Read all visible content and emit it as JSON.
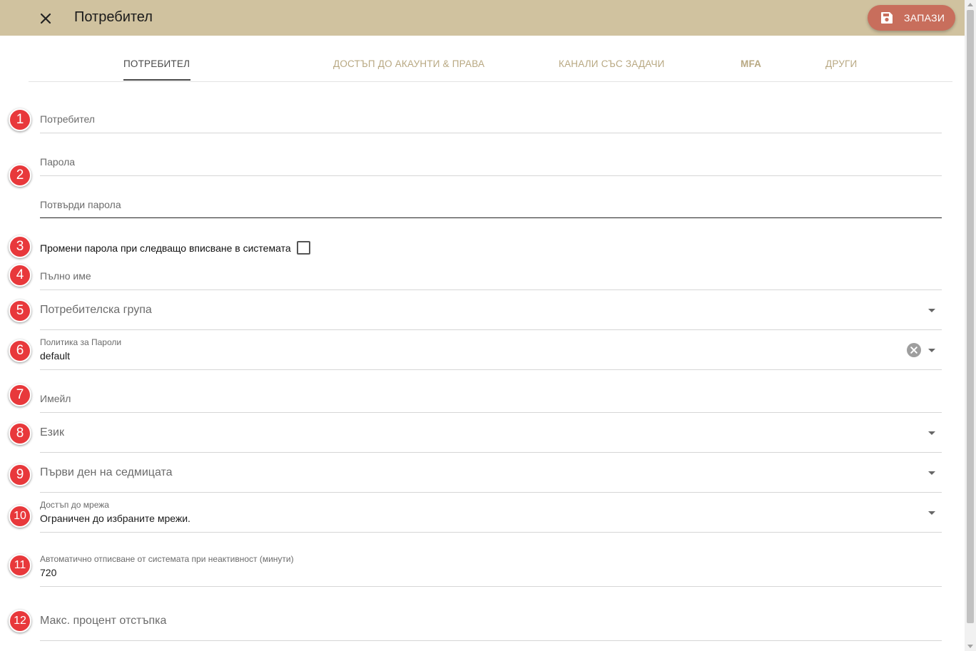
{
  "header": {
    "title": "Потребител",
    "save_label": "ЗАПАЗИ"
  },
  "tabs": [
    {
      "label": "Потребител",
      "active": true
    },
    {
      "label": "Достъп до акаунти & права",
      "active": false
    },
    {
      "label": "Канали със задачи",
      "active": false
    },
    {
      "label": "MFA",
      "active": false
    },
    {
      "label": "Други",
      "active": false
    }
  ],
  "form": {
    "username": {
      "placeholder": "Потребител"
    },
    "password": {
      "placeholder": "Парола"
    },
    "confirm_password": {
      "placeholder": "Потвърди парола"
    },
    "change_password_next_login": {
      "label": "Промени парола при следващо вписване в системата",
      "checked": false
    },
    "full_name": {
      "placeholder": "Пълно име"
    },
    "user_group": {
      "placeholder": "Потребителска група"
    },
    "password_policy": {
      "label": "Политика за Пароли",
      "value": "default"
    },
    "email": {
      "placeholder": "Имейл"
    },
    "language": {
      "placeholder": "Език"
    },
    "first_day_of_week": {
      "placeholder": "Първи ден на седмицата"
    },
    "network_access": {
      "label": "Достъп до мрежа",
      "value": "Ограничен до избраните мрежи."
    },
    "auto_logout": {
      "label": "Автоматично отписване от системата при неактивност (минути)",
      "value": "720"
    },
    "max_discount": {
      "placeholder": "Макс. процент отстъпка"
    }
  },
  "markers": [
    "1",
    "2",
    "3",
    "4",
    "5",
    "6",
    "7",
    "8",
    "9",
    "10",
    "11",
    "12"
  ],
  "colors": {
    "header_bg": "#d0c29f",
    "save_button": "#c86e5c",
    "tab_inactive": "#b8a882",
    "marker": "#e8383b"
  }
}
